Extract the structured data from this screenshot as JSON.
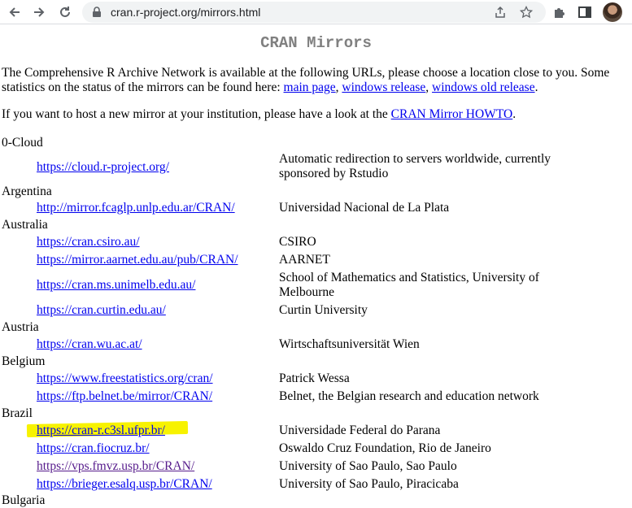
{
  "browser": {
    "url": "cran.r-project.org/mirrors.html"
  },
  "page": {
    "title": "CRAN Mirrors",
    "intro_text_1": "The Comprehensive R Archive Network is available at the following URLs, please choose a location close to you. Some statistics on the status of the mirrors can be found here: ",
    "intro_links": [
      "main page",
      "windows release",
      "windows old release"
    ],
    "sep_comma": ", ",
    "end_period": ".",
    "host_text": "If you want to host a new mirror at your institution, please have a look at the ",
    "howto_link": "CRAN Mirror HOWTO"
  },
  "sections": [
    {
      "country": "0-Cloud",
      "mirrors": [
        {
          "url": "https://cloud.r-project.org/",
          "desc": "Automatic redirection to servers worldwide, currently sponsored by Rstudio"
        }
      ]
    },
    {
      "country": "Argentina",
      "mirrors": [
        {
          "url": "http://mirror.fcaglp.unlp.edu.ar/CRAN/",
          "desc": "Universidad Nacional de La Plata"
        }
      ]
    },
    {
      "country": "Australia",
      "mirrors": [
        {
          "url": "https://cran.csiro.au/",
          "desc": "CSIRO"
        },
        {
          "url": "https://mirror.aarnet.edu.au/pub/CRAN/",
          "desc": "AARNET"
        },
        {
          "url": "https://cran.ms.unimelb.edu.au/",
          "desc": "School of Mathematics and Statistics, University of Melbourne"
        },
        {
          "url": "https://cran.curtin.edu.au/",
          "desc": "Curtin University"
        }
      ]
    },
    {
      "country": "Austria",
      "mirrors": [
        {
          "url": "https://cran.wu.ac.at/",
          "desc": "Wirtschaftsuniversität Wien"
        }
      ]
    },
    {
      "country": "Belgium",
      "mirrors": [
        {
          "url": "https://www.freestatistics.org/cran/",
          "desc": "Patrick Wessa"
        },
        {
          "url": "https://ftp.belnet.be/mirror/CRAN/",
          "desc": "Belnet, the Belgian research and education network"
        }
      ]
    },
    {
      "country": "Brazil",
      "mirrors": [
        {
          "url": "https://cran-r.c3sl.ufpr.br/",
          "desc": "Universidade Federal do Parana"
        },
        {
          "url": "https://cran.fiocruz.br/",
          "desc": "Oswaldo Cruz Foundation, Rio de Janeiro"
        },
        {
          "url": "https://vps.fmvz.usp.br/CRAN/",
          "desc": "University of Sao Paulo, Sao Paulo"
        },
        {
          "url": "https://brieger.esalq.usp.br/CRAN/",
          "desc": "University of Sao Paulo, Piracicaba"
        }
      ]
    },
    {
      "country": "Bulgaria",
      "mirrors": []
    }
  ],
  "colors": {
    "link": "#0000ee",
    "visited": "#551a8b",
    "title": "#808080",
    "highlight": "#f7f200"
  }
}
